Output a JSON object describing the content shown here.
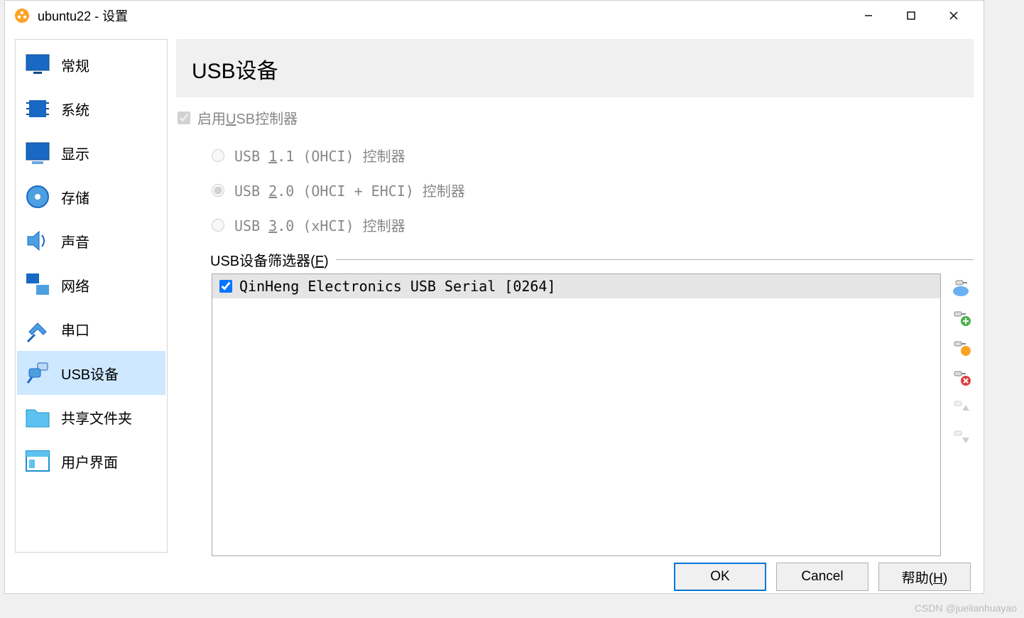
{
  "window_title": "ubuntu22 - 设置",
  "sidebar": {
    "items": [
      {
        "label": "常规",
        "icon": "monitor"
      },
      {
        "label": "系统",
        "icon": "chip"
      },
      {
        "label": "显示",
        "icon": "screen"
      },
      {
        "label": "存储",
        "icon": "disk"
      },
      {
        "label": "声音",
        "icon": "speaker"
      },
      {
        "label": "网络",
        "icon": "network"
      },
      {
        "label": "串口",
        "icon": "serial"
      },
      {
        "label": "USB设备",
        "icon": "usb"
      },
      {
        "label": "共享文件夹",
        "icon": "folder"
      },
      {
        "label": "用户界面",
        "icon": "ui"
      }
    ],
    "selected_index": 7
  },
  "page": {
    "title": "USB设备",
    "enable_checkbox": "启用USB控制器",
    "enable_checked": true,
    "usb_underline_char": "U",
    "radios": [
      {
        "pre": "USB ",
        "u": "1",
        "post": ".1 (OHCI) 控制器",
        "checked": false
      },
      {
        "pre": "USB ",
        "u": "2",
        "post": ".0 (OHCI + EHCI) 控制器",
        "checked": true
      },
      {
        "pre": "USB ",
        "u": "3",
        "post": ".0 (xHCI) 控制器",
        "checked": false
      }
    ],
    "filter_heading_pre": "USB设备筛选器(",
    "filter_heading_u": "F",
    "filter_heading_post": ")",
    "filters": [
      {
        "label": "QinHeng Electronics USB Serial [0264]",
        "checked": true
      }
    ]
  },
  "buttons": {
    "ok": "OK",
    "cancel": "Cancel",
    "help_pre": "帮助(",
    "help_u": "H",
    "help_post": ")"
  },
  "watermark": "CSDN @juelianhuayao"
}
